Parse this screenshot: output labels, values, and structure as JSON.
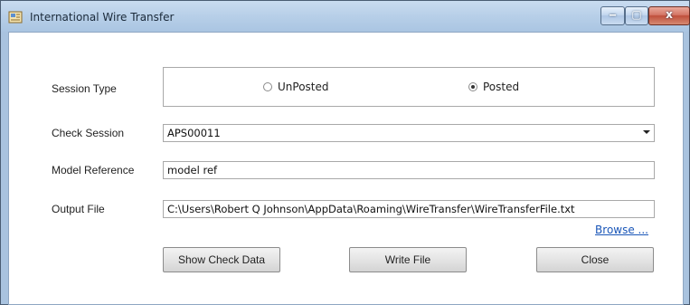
{
  "window": {
    "title": "International Wire Transfer",
    "controls": {
      "minimize": "‒",
      "maximize": "▢",
      "close": "x"
    }
  },
  "form": {
    "session_type": {
      "label": "Session Type",
      "options": [
        {
          "label": "UnPosted",
          "checked": false
        },
        {
          "label": "Posted",
          "checked": true
        }
      ]
    },
    "check_session": {
      "label": "Check Session",
      "value": "APS00011"
    },
    "model_reference": {
      "label": "Model Reference",
      "value": "model ref"
    },
    "output_file": {
      "label": "Output File",
      "value": "C:\\Users\\Robert Q Johnson\\AppData\\Roaming\\WireTransfer\\WireTransferFile.txt"
    },
    "browse_link": "Browse ..."
  },
  "buttons": {
    "show_check_data": "Show Check Data",
    "write_file": "Write File",
    "close": "Close"
  }
}
